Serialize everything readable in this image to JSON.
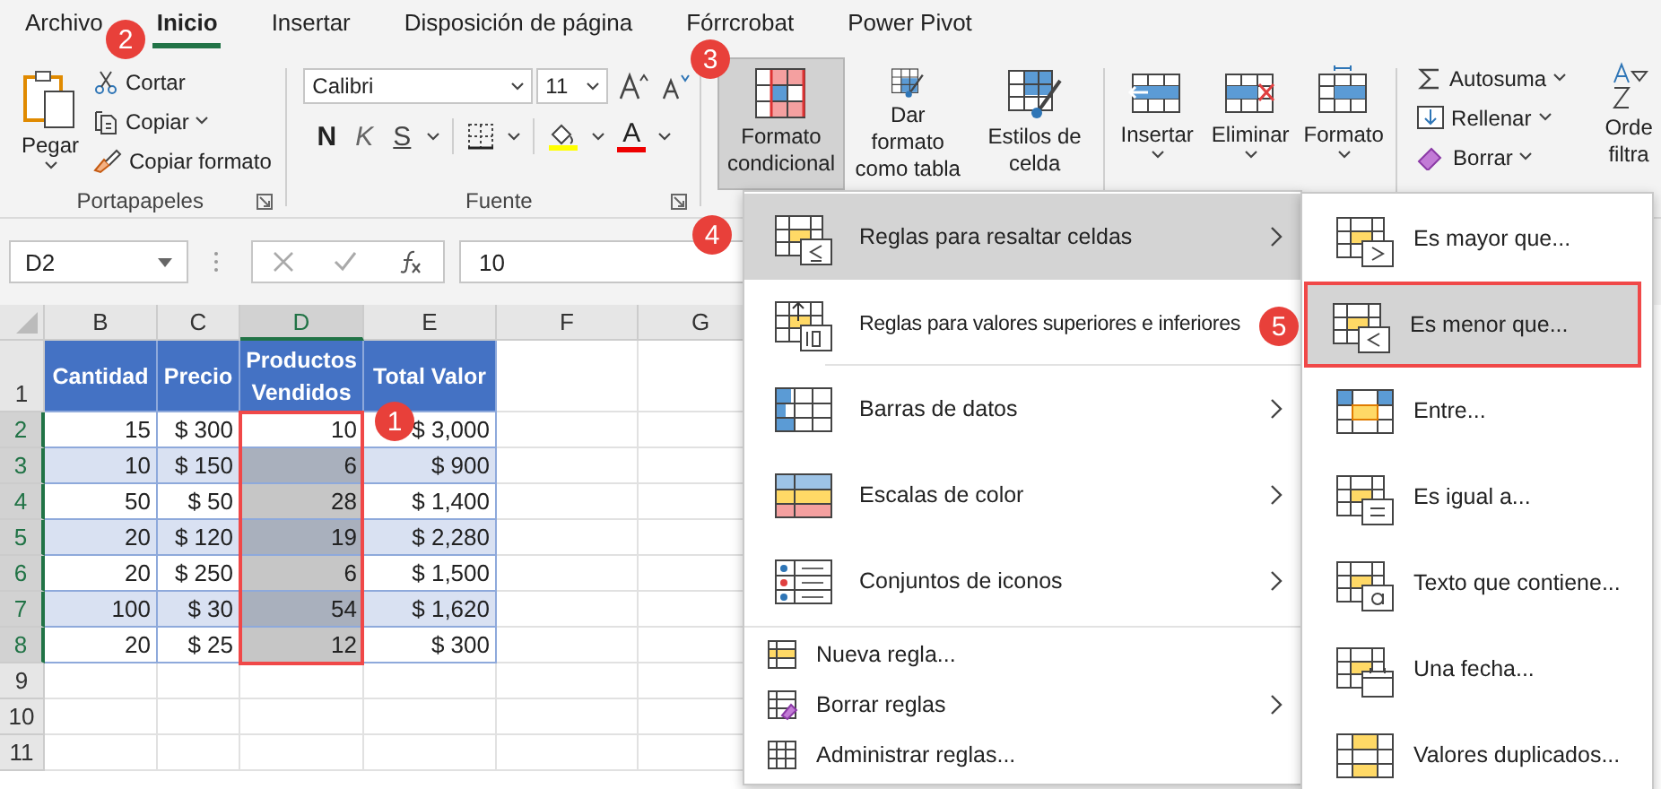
{
  "tabs": [
    {
      "label": "Archivo",
      "selected": false
    },
    {
      "label": "Inicio",
      "selected": true
    },
    {
      "label": "Insertar",
      "selected": false
    },
    {
      "label": "Disposición de página",
      "selected": false
    },
    {
      "label": "Fórrcrobat",
      "selected": false
    },
    {
      "label": "Power Pivot",
      "selected": false
    }
  ],
  "clipboard": {
    "paste": "Pegar",
    "cut": "Cortar",
    "copy": "Copiar",
    "format_painter": "Copiar formato",
    "group_label": "Portapapeles"
  },
  "font": {
    "family": "Calibri",
    "size": "11",
    "bold": "N",
    "italic": "K",
    "underline": "S",
    "font_color": "A",
    "group_label": "Fuente"
  },
  "styles": [
    {
      "label": "Formato condicional",
      "selected": true
    },
    {
      "label": "Dar formato como tabla",
      "selected": false
    },
    {
      "label": "Estilos de celda",
      "selected": false
    }
  ],
  "cells": [
    "Insertar",
    "Eliminar",
    "Formato"
  ],
  "editing": {
    "items": [
      "Autosuma",
      "Rellenar",
      "Borrar"
    ],
    "sort": "Orde filtra"
  },
  "formula_bar": {
    "name_box": "D2",
    "value": "10"
  },
  "columns": [
    {
      "label": "B",
      "selected": false
    },
    {
      "label": "C",
      "selected": false
    },
    {
      "label": "D",
      "selected": true
    },
    {
      "label": "E",
      "selected": false
    },
    {
      "label": "F",
      "selected": false
    },
    {
      "label": "G",
      "selected": false
    }
  ],
  "header": {
    "number": "1",
    "cells": [
      "Cantidad",
      "Precio",
      "Productos Vendidos",
      "Total Valor"
    ]
  },
  "rows": [
    {
      "number": "2",
      "selected": true,
      "active": true,
      "cells": [
        "15",
        "$ 300",
        "10",
        "$ 3,000"
      ]
    },
    {
      "number": "3",
      "selected": true,
      "active": false,
      "cells": [
        "10",
        "$ 150",
        "6",
        "$ 900"
      ]
    },
    {
      "number": "4",
      "selected": true,
      "active": false,
      "cells": [
        "50",
        "$ 50",
        "28",
        "$ 1,400"
      ]
    },
    {
      "number": "5",
      "selected": true,
      "active": false,
      "cells": [
        "20",
        "$ 120",
        "19",
        "$ 2,280"
      ]
    },
    {
      "number": "6",
      "selected": true,
      "active": false,
      "cells": [
        "20",
        "$ 250",
        "6",
        "$ 1,500"
      ]
    },
    {
      "number": "7",
      "selected": true,
      "active": false,
      "cells": [
        "100",
        "$ 30",
        "54",
        "$ 1,620"
      ]
    },
    {
      "number": "8",
      "selected": true,
      "active": false,
      "cells": [
        "20",
        "$ 25",
        "12",
        "$ 300"
      ]
    },
    {
      "number": "9",
      "selected": false
    },
    {
      "number": "10",
      "selected": false
    },
    {
      "number": "11",
      "selected": false
    }
  ],
  "menu": [
    {
      "kind": "large",
      "label": "Reglas para resaltar celdas",
      "selected": true,
      "arrow": true
    },
    {
      "kind": "large",
      "label": "Reglas para valores superiores e inferiores",
      "selected": false
    },
    {
      "kind": "large",
      "label": "Barras de datos",
      "selected": false,
      "arrow": true
    },
    {
      "kind": "large",
      "label": "Escalas de color",
      "selected": false,
      "arrow": true
    },
    {
      "kind": "large",
      "label": "Conjuntos de iconos",
      "selected": false,
      "arrow": true
    },
    {
      "kind": "small",
      "label": "Nueva regla...",
      "selected": false,
      "arrow": false
    },
    {
      "kind": "small",
      "label": "Borrar reglas",
      "selected": false,
      "arrow": true
    },
    {
      "kind": "small",
      "label": "Administrar reglas...",
      "selected": false,
      "arrow": false
    }
  ],
  "submenu": [
    {
      "label": "Es mayor que...",
      "selected": false
    },
    {
      "label": "Es menor que...",
      "selected": true
    },
    {
      "label": "Entre...",
      "selected": false
    },
    {
      "label": "Es igual a...",
      "selected": false
    },
    {
      "label": "Texto que contiene...",
      "selected": false
    },
    {
      "label": "Una fecha...",
      "selected": false
    },
    {
      "label": "Valores duplicados...",
      "selected": false
    }
  ],
  "callouts": [
    "1",
    "2",
    "3",
    "4",
    "5"
  ]
}
